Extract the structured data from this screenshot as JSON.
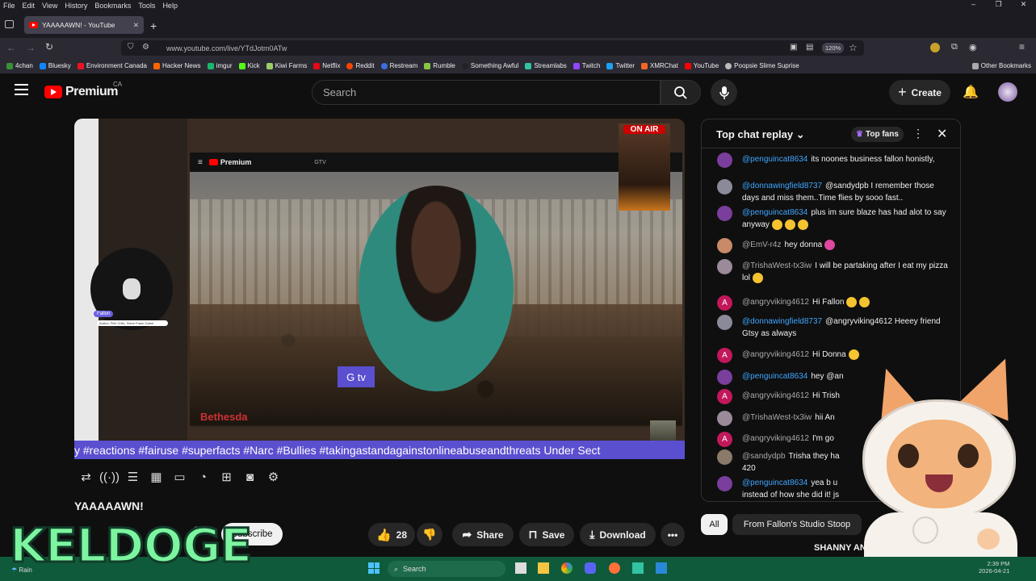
{
  "browser": {
    "menu": [
      "File",
      "Edit",
      "View",
      "History",
      "Bookmarks",
      "Tools",
      "Help"
    ],
    "tab_title": "YAAAAAWN! - YouTube",
    "url": "www.youtube.com/live/YTdJotm0ATw",
    "zoom": "120%",
    "bookmarks": [
      "4chan",
      "Bluesky",
      "Environment Canada",
      "Hacker News",
      "imgur",
      "Kick",
      "Kiwi Farms",
      "Netflix",
      "Reddit",
      "Restream",
      "Rumble",
      "Something Awful",
      "Streamlabs",
      "Twitch",
      "Twitter",
      "XMRChat",
      "YouTube",
      "Poopsie Slime Suprise"
    ],
    "other_bookmarks": "Other Bookmarks"
  },
  "yt": {
    "logo": "Premium",
    "country": "CA",
    "search_placeholder": "Search",
    "create_label": "Create"
  },
  "video": {
    "ticker": "y #reactions #fairuse #superfacts #Narc #Bullies #takingastandagainstonlineabuseandthreats Under Sect",
    "on_air": "ON AIR",
    "gtv": "G tv",
    "watermark": "Bethesda",
    "inner_logo": "Premium",
    "inner_search": "GTV",
    "name_tag": "Fallon",
    "name_sub": "Author, Film Critic, Steve Frank Game"
  },
  "below": {
    "title": "YAAAAAWN!",
    "channel_tail": "op",
    "subscribe": "Subscribe",
    "likes": "28",
    "share": "Share",
    "save": "Save",
    "download": "Download"
  },
  "chat": {
    "header": "Top chat replay",
    "top_fans": "Top fans",
    "messages": [
      {
        "user": "@penguincat8634",
        "text": "its noones business fallon honistly,",
        "avatar": "#7a3e9d",
        "letter": ""
      },
      {
        "user": "@donnawingfield8737",
        "text": "@sandydpb I remember those days and miss them..Time flies by sooo fast..",
        "avatar": "#8a8a9a",
        "letter": ""
      },
      {
        "user": "@penguincat8634",
        "text": "plus im sure blaze has had alot to say anyway",
        "avatar": "#7a3e9d",
        "letter": ""
      },
      {
        "user": "@EmV-r4z",
        "text": "hey donna",
        "avatar": "#c98a6a",
        "letter": ""
      },
      {
        "user": "@TrishaWest-tx3iw",
        "text": "I will be partaking   after I eat my pizza lol",
        "avatar": "#9a8a9a",
        "letter": ""
      },
      {
        "user": "@angryviking4612",
        "text": "Hi Fallon",
        "avatar": "#c2185b",
        "letter": "A"
      },
      {
        "user": "@donnawingfield8737",
        "text": "@angryviking4612 Heeey friend      Gtsy as always",
        "avatar": "#8a8a9a",
        "letter": ""
      },
      {
        "user": "@angryviking4612",
        "text": "Hi Donna",
        "avatar": "#c2185b",
        "letter": "A"
      },
      {
        "user": "@penguincat8634",
        "text": "hey @an",
        "avatar": "#7a3e9d",
        "letter": ""
      },
      {
        "user": "@angryviking4612",
        "text": "Hi Trish",
        "avatar": "#c2185b",
        "letter": "A"
      },
      {
        "user": "@TrishaWest-tx3iw",
        "text": "hii An",
        "avatar": "#9a8a9a",
        "letter": ""
      },
      {
        "user": "@angryviking4612",
        "text": "I'm go",
        "avatar": "#c2185b",
        "letter": "A"
      },
      {
        "user": "@sandydpb",
        "text": "Trisha they ha 420",
        "avatar": "#8a7a6a",
        "letter": ""
      },
      {
        "user": "@penguincat8634",
        "text": "yea b u instead of how she did it! js",
        "avatar": "#7a3e9d",
        "letter": ""
      }
    ],
    "chip_all": "All",
    "chip_studio": "From Fallon's Studio Stoop",
    "overlay_name": "SHANNY AND F"
  },
  "overlay": {
    "keldoge": "KELDOGE"
  },
  "taskbar": {
    "weather": "Rain",
    "search": "Search",
    "time": "2:39 PM",
    "date": "2026-04-21"
  }
}
